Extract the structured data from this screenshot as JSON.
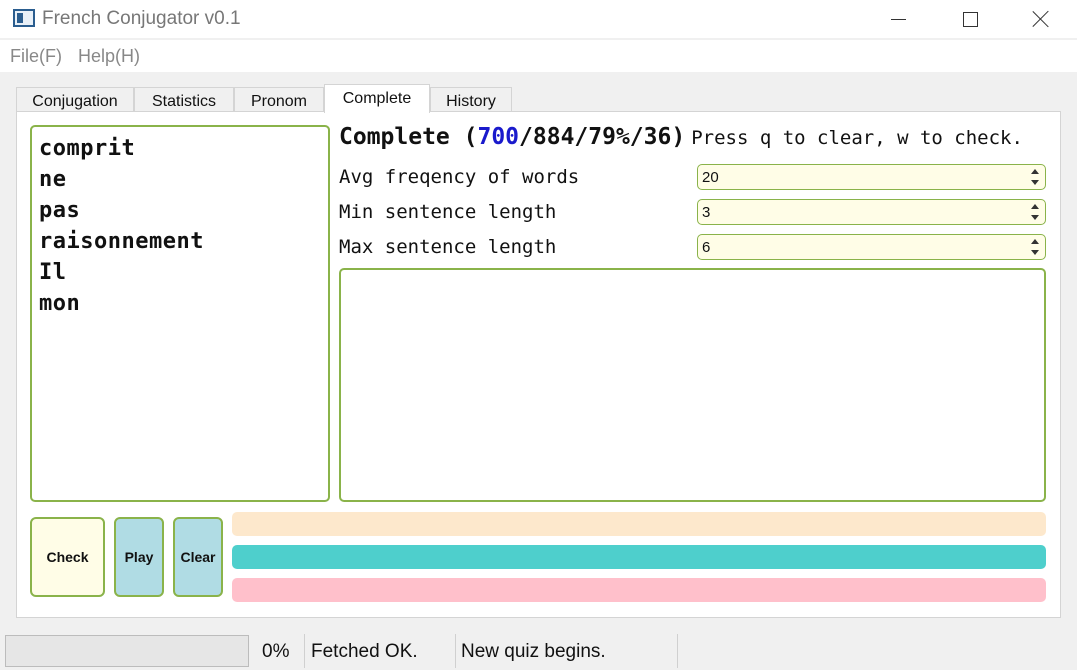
{
  "window": {
    "title": "French Conjugator v0.1",
    "controls": {
      "minimize": "minimize-icon",
      "maximize": "maximize-icon",
      "close": "close-icon"
    }
  },
  "menu": {
    "file": "File(F)",
    "help": "Help(H)"
  },
  "tabs": [
    {
      "label": "Conjugation",
      "active": false
    },
    {
      "label": "Statistics",
      "active": false
    },
    {
      "label": "Pronom",
      "active": false
    },
    {
      "label": "Complete",
      "active": true
    },
    {
      "label": "History",
      "active": false
    }
  ],
  "words": [
    "comprit",
    "ne",
    "pas",
    "raisonnement",
    "Il",
    "mon"
  ],
  "header": {
    "prefix": "Complete (",
    "highlight": "700",
    "suffix": "/884/79%/36)",
    "instruction": "Press q to clear, w to check."
  },
  "settings": [
    {
      "label": "Avg freqency of words",
      "value": "20"
    },
    {
      "label": "Min sentence length",
      "value": "3"
    },
    {
      "label": "Max sentence length",
      "value": "6"
    }
  ],
  "answer_text": "",
  "buttons": {
    "check": "Check",
    "play": "Play",
    "clear": "Clear"
  },
  "feedback_bars": [
    "",
    "",
    ""
  ],
  "colors": {
    "accent_border": "#8ab34a",
    "highlight_number": "#1a1acc",
    "bar_1": "#fde8cc",
    "bar_2": "#4ecfcc",
    "bar_3": "#ffc0cb",
    "spin_background": "#fffde7"
  },
  "status": {
    "progress_percent": 0,
    "percent_label": "0%",
    "fetch": "Fetched OK.",
    "message": "New quiz begins."
  }
}
